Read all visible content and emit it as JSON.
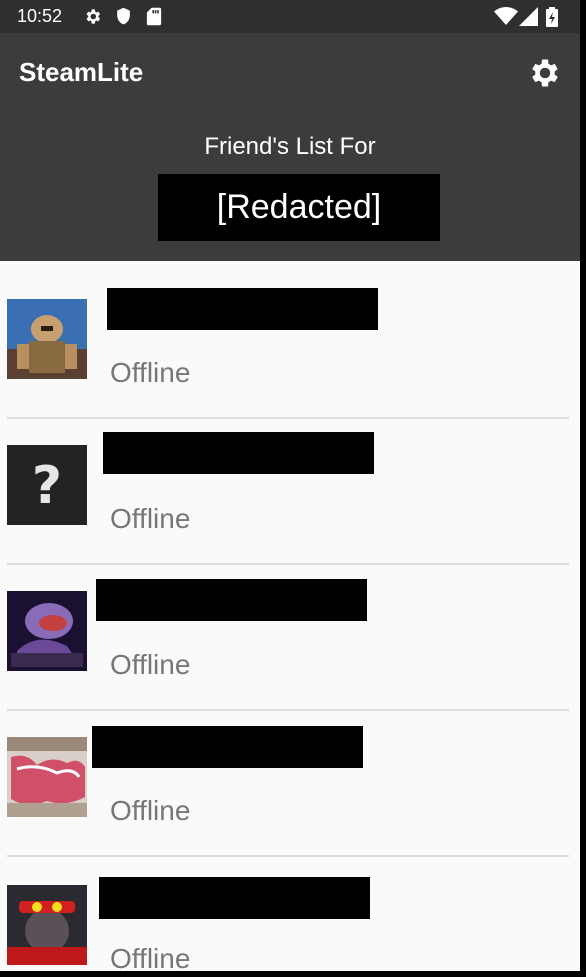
{
  "status_bar": {
    "time": "10:52",
    "icons": [
      "gear-icon",
      "shield-icon",
      "sd-card-icon",
      "wifi-icon",
      "signal-icon",
      "battery-icon"
    ]
  },
  "app": {
    "title": "SteamLite",
    "settings_icon": "gear-icon",
    "header_label": "Friend's List For",
    "username": "[Redacted]"
  },
  "friends": [
    {
      "avatar": "warrior-avatar",
      "status": "Offline"
    },
    {
      "avatar": "question-mark-avatar",
      "status": "Offline"
    },
    {
      "avatar": "viper-avatar",
      "status": "Offline"
    },
    {
      "avatar": "graffiti-avatar",
      "status": "Offline"
    },
    {
      "avatar": "dog-avatar",
      "status": "Offline"
    }
  ],
  "colors": {
    "status_bar": "#2f2f2f",
    "app_bar": "#3c3c3c",
    "list_background": "#fafafa",
    "status_text": "#777777",
    "divider": "#dddddd"
  }
}
